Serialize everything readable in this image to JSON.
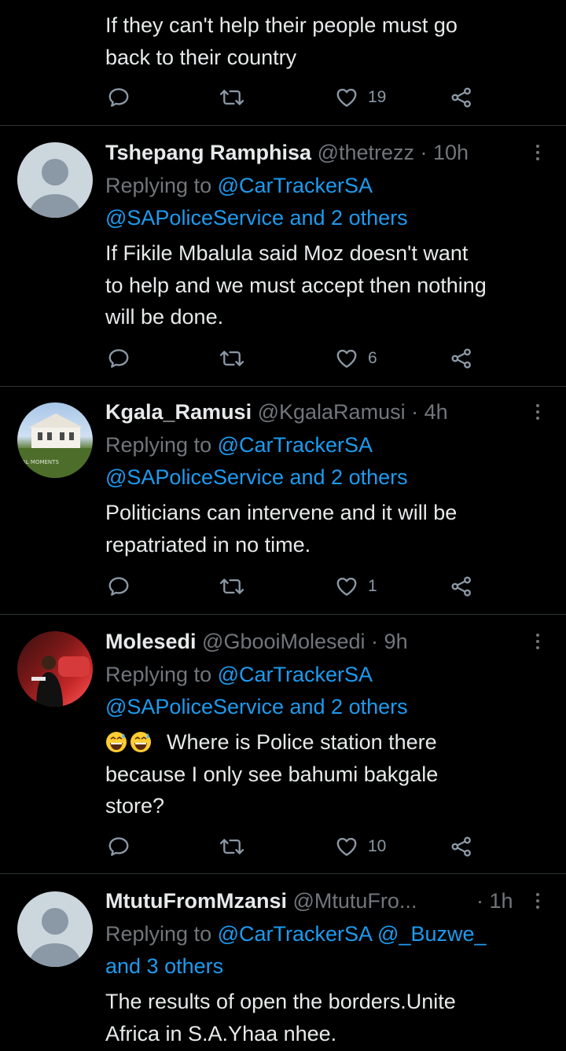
{
  "colors": {
    "background": "#000000",
    "text": "#e7e9ea",
    "muted": "#71767b",
    "link": "#1d9bf0",
    "divider": "#2f3336"
  },
  "top_tweet": {
    "text": "If they can't help their people must go\nback to their country",
    "likes": "19"
  },
  "tweets": [
    {
      "name": "Tshepang Ramphisa",
      "meta": "@thetrezz · 10h",
      "replying_prefix": "Replying to ",
      "mention_1": "@CarTrackerSA",
      "mention_2": "@SAPoliceService and 2 others",
      "text": "If Fikile Mbalula said Moz doesn't want\nto help and we must accept then nothing\nwill be done.",
      "likes": "6",
      "avatar": "default-avatar"
    },
    {
      "name": "Kgala_Ramusi",
      "meta": "@KgalaRamusi · 4h",
      "replying_prefix": "Replying to ",
      "mention_1": "@CarTrackerSA",
      "mention_2": "@SAPoliceService and 2 others",
      "text": "Politicians can intervene and it will be\nrepatriated in no time.",
      "likes": "1",
      "avatar": "house-photo-avatar",
      "avatar_text": "AL MOMENTS"
    },
    {
      "name": "Molesedi",
      "meta": "@GbooiMolesedi · 9h",
      "replying_prefix": "Replying to ",
      "mention_1": "@CarTrackerSA",
      "mention_2": "@SAPoliceService and 2 others",
      "text": "Where is Police station there\nbecause I only see bahumi bakgale\nstore?",
      "emoji": "grinning-sweat-emoji",
      "likes": "10",
      "avatar": "person-photo-avatar"
    },
    {
      "name": "MtutuFromMzansi",
      "meta": "@MtutuFro...",
      "time": "· 1h",
      "replying_prefix": "Replying to ",
      "mention_1": "@CarTrackerSA @_Buzwe_",
      "mention_2": "and 3 others",
      "text": "The results of open the borders.Unite\nAfrica in S.A.Yhaa nhee.",
      "avatar": "default-avatar"
    }
  ],
  "icons": [
    "reply-icon",
    "retweet-icon",
    "like-icon",
    "share-icon",
    "more-options-icon"
  ]
}
